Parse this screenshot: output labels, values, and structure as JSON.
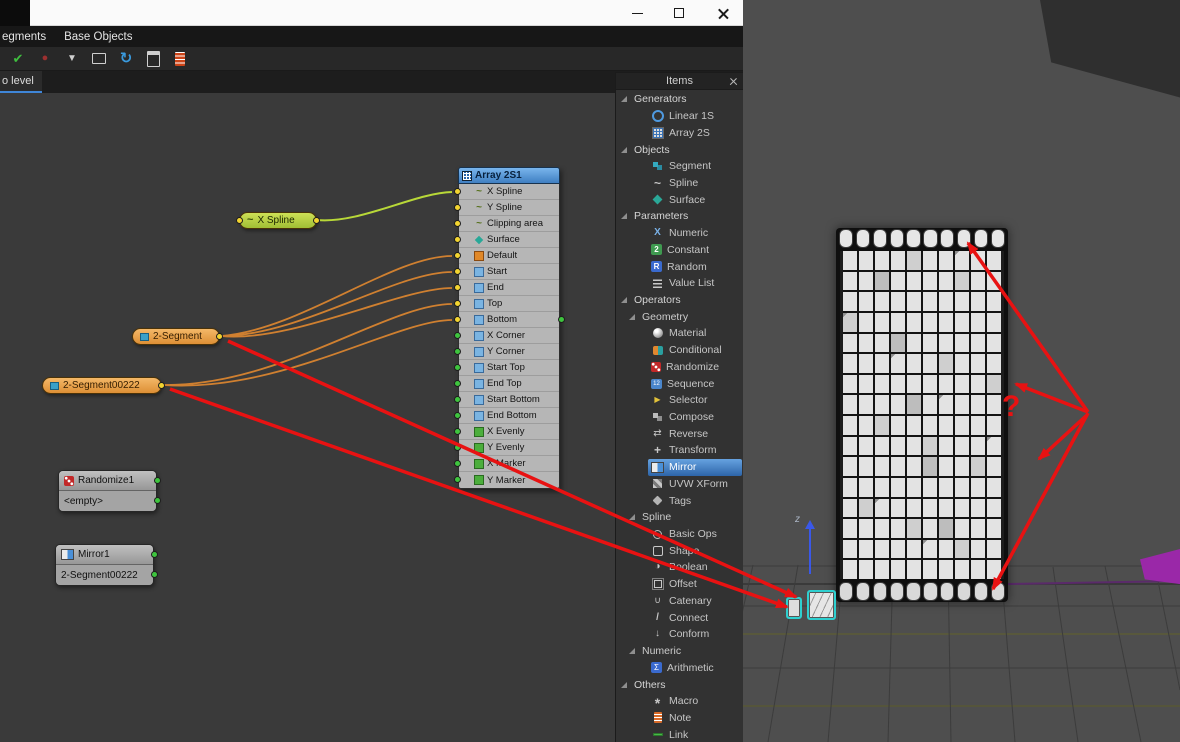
{
  "window": {
    "menu_items": [
      "egments",
      "Base Objects"
    ],
    "toolbar_icons": [
      "apply-check-icon",
      "record-icon",
      "filter-icon",
      "display-icon",
      "refresh-icon",
      "export-icon",
      "notes-icon"
    ],
    "tab_label": "o level",
    "controls": [
      "minimize",
      "maximize",
      "close"
    ]
  },
  "canvas": {
    "array_node": {
      "title": "Array 2S1",
      "inputs": [
        {
          "label": "X Spline",
          "icon": "spline",
          "dot": "yellow"
        },
        {
          "label": "Y Spline",
          "icon": "spline",
          "dot": "yellow"
        },
        {
          "label": "Clipping area",
          "icon": "spline",
          "dot": "yellow"
        },
        {
          "label": "Surface",
          "icon": "surface",
          "dot": "yellow"
        },
        {
          "label": "Default",
          "icon": "default",
          "dot": "yellow"
        },
        {
          "label": "Start",
          "icon": "slot",
          "dot": "yellow"
        },
        {
          "label": "End",
          "icon": "slot",
          "dot": "yellow"
        },
        {
          "label": "Top",
          "icon": "slot",
          "dot": "yellow"
        },
        {
          "label": "Bottom",
          "icon": "slot",
          "dot": "yellow"
        },
        {
          "label": "X Corner",
          "icon": "slot",
          "dot": "green"
        },
        {
          "label": "Y Corner",
          "icon": "slot",
          "dot": "green"
        },
        {
          "label": "Start Top",
          "icon": "slot",
          "dot": "green"
        },
        {
          "label": "End Top",
          "icon": "slot",
          "dot": "green"
        },
        {
          "label": "Start Bottom",
          "icon": "slot",
          "dot": "green"
        },
        {
          "label": "End Bottom",
          "icon": "slot",
          "dot": "green"
        },
        {
          "label": "X Evenly",
          "icon": "evenly",
          "dot": "green"
        },
        {
          "label": "Y Evenly",
          "icon": "evenly",
          "dot": "green"
        },
        {
          "label": "X Marker",
          "icon": "evenly",
          "dot": "green"
        },
        {
          "label": "Y Marker",
          "icon": "evenly",
          "dot": "green"
        }
      ]
    },
    "nodes": {
      "x_spline": {
        "label": "X Spline"
      },
      "segment1": {
        "label": "2-Segment"
      },
      "segment2": {
        "label": "2-Segment00222"
      },
      "randomize": {
        "title": "Randomize1",
        "sub": "<empty>"
      },
      "mirror": {
        "title": "Mirror1",
        "sub": "2-Segment00222"
      }
    }
  },
  "items_panel": {
    "title": "Items",
    "entries": [
      {
        "label": "Generators",
        "type": "section"
      },
      {
        "label": "Linear 1S",
        "type": "item",
        "icon": "linear-1s"
      },
      {
        "label": "Array 2S",
        "type": "item",
        "icon": "array-2s"
      },
      {
        "label": "Objects",
        "type": "section"
      },
      {
        "label": "Segment",
        "type": "item",
        "icon": "segment"
      },
      {
        "label": "Spline",
        "type": "item",
        "icon": "spline"
      },
      {
        "label": "Surface",
        "type": "item",
        "icon": "surface"
      },
      {
        "label": "Parameters",
        "type": "section"
      },
      {
        "label": "Numeric",
        "type": "item",
        "icon": "numeric"
      },
      {
        "label": "Constant",
        "type": "item",
        "icon": "constant"
      },
      {
        "label": "Random",
        "type": "item",
        "icon": "random"
      },
      {
        "label": "Value List",
        "type": "item",
        "icon": "value-list"
      },
      {
        "label": "Operators",
        "type": "section"
      },
      {
        "label": "Geometry",
        "type": "subsection"
      },
      {
        "label": "Material",
        "type": "item",
        "icon": "material"
      },
      {
        "label": "Conditional",
        "type": "item",
        "icon": "conditional"
      },
      {
        "label": "Randomize",
        "type": "item",
        "icon": "randomize"
      },
      {
        "label": "Sequence",
        "type": "item",
        "icon": "sequence"
      },
      {
        "label": "Selector",
        "type": "item",
        "icon": "selector"
      },
      {
        "label": "Compose",
        "type": "item",
        "icon": "compose"
      },
      {
        "label": "Reverse",
        "type": "item",
        "icon": "reverse"
      },
      {
        "label": "Transform",
        "type": "item",
        "icon": "transform"
      },
      {
        "label": "Mirror",
        "type": "item",
        "icon": "mirror",
        "selected": true
      },
      {
        "label": "UVW XForm",
        "type": "item",
        "icon": "uvw-xform"
      },
      {
        "label": "Tags",
        "type": "item",
        "icon": "tags"
      },
      {
        "label": "Spline",
        "type": "subsection"
      },
      {
        "label": "Basic Ops",
        "type": "item",
        "icon": "basic-ops"
      },
      {
        "label": "Shape",
        "type": "item",
        "icon": "shape"
      },
      {
        "label": "Boolean",
        "type": "item",
        "icon": "boolean"
      },
      {
        "label": "Offset",
        "type": "item",
        "icon": "offset"
      },
      {
        "label": "Catenary",
        "type": "item",
        "icon": "catenary"
      },
      {
        "label": "Connect",
        "type": "item",
        "icon": "connect"
      },
      {
        "label": "Conform",
        "type": "item",
        "icon": "conform"
      },
      {
        "label": "Numeric",
        "type": "subsection"
      },
      {
        "label": "Arithmetic",
        "type": "item",
        "icon": "arithmetic"
      },
      {
        "label": "Others",
        "type": "section"
      },
      {
        "label": "Macro",
        "type": "item",
        "icon": "macro"
      },
      {
        "label": "Note",
        "type": "item",
        "icon": "note"
      },
      {
        "label": "Link",
        "type": "item",
        "icon": "link"
      }
    ]
  },
  "viewport": {
    "annotation": "?",
    "axis_label": "z",
    "building": {
      "cols": 10,
      "rows": 16
    }
  },
  "colors": {
    "selection_blue": "#3f86d8",
    "wire_green": "#b8d838",
    "wire_orange": "#d08030",
    "annotation_red": "#e81212",
    "node_orange": "#dd8f35",
    "node_green": "#a0be34"
  }
}
